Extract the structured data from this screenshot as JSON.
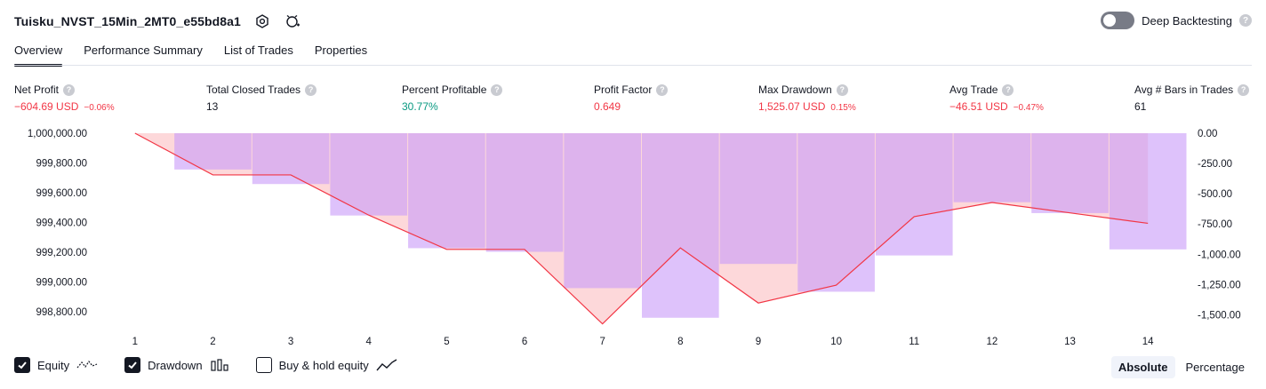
{
  "header": {
    "title": "Tuisku_NVST_15Min_2MT0_e55bd8a1",
    "deep_label": "Deep Backtesting",
    "help_glyph": "?"
  },
  "tabs": [
    {
      "label": "Overview",
      "active": true
    },
    {
      "label": "Performance Summary",
      "active": false
    },
    {
      "label": "List of Trades",
      "active": false
    },
    {
      "label": "Properties",
      "active": false
    }
  ],
  "metrics": [
    {
      "label": "Net Profit",
      "value": "−604.69 USD",
      "pct": "−0.06%",
      "tone": "neg"
    },
    {
      "label": "Total Closed Trades",
      "value": "13",
      "pct": "",
      "tone": "neutral"
    },
    {
      "label": "Percent Profitable",
      "value": "30.77%",
      "pct": "",
      "tone": "pos"
    },
    {
      "label": "Profit Factor",
      "value": "0.649",
      "pct": "",
      "tone": "neg"
    },
    {
      "label": "Max Drawdown",
      "value": "1,525.07 USD",
      "pct": "0.15%",
      "tone": "neg"
    },
    {
      "label": "Avg Trade",
      "value": "−46.51 USD",
      "pct": "−0.47%",
      "tone": "neg"
    },
    {
      "label": "Avg # Bars in Trades",
      "value": "61",
      "pct": "",
      "tone": "neutral"
    }
  ],
  "chart_data": {
    "type": "line",
    "x": [
      1,
      2,
      3,
      4,
      5,
      6,
      7,
      8,
      9,
      10,
      11,
      12,
      13,
      14
    ],
    "series": [
      {
        "name": "Equity",
        "axis": "left",
        "type": "line",
        "values": [
          1000000,
          999720,
          999720,
          999450,
          999220,
          999220,
          998720,
          999230,
          998860,
          998980,
          999440,
          999535,
          999465,
          999395
        ]
      },
      {
        "name": "Drawdown",
        "axis": "right",
        "type": "bar",
        "values": [
          0,
          -300,
          -420,
          -680,
          -950,
          -980,
          -1280,
          -1525,
          -1080,
          -1310,
          -1010,
          -570,
          -660,
          -960
        ]
      }
    ],
    "left_ticks": [
      "1,000,000.00",
      "999,800.00",
      "999,600.00",
      "999,400.00",
      "999,200.00",
      "999,000.00",
      "998,800.00"
    ],
    "right_ticks": [
      "0.00",
      "-250.00",
      "-500.00",
      "-750.00",
      "-1,000.00",
      "-1,250.00",
      "-1,500.00"
    ],
    "left_ylim": [
      998700,
      1000000
    ],
    "right_ylim": [
      -1600,
      0
    ],
    "colors": {
      "equity": "#f23645",
      "drawdown": "#ce93d8",
      "equity_fill": "#fccbcd"
    }
  },
  "legend": [
    {
      "label": "Equity",
      "checked": true,
      "icon": "equity-line-icon"
    },
    {
      "label": "Drawdown",
      "checked": true,
      "icon": "drawdown-bars-icon"
    },
    {
      "label": "Buy & hold equity",
      "checked": false,
      "icon": "buy-hold-line-icon"
    }
  ],
  "mode": {
    "absolute_label": "Absolute",
    "percentage_label": "Percentage",
    "active": "Absolute"
  }
}
